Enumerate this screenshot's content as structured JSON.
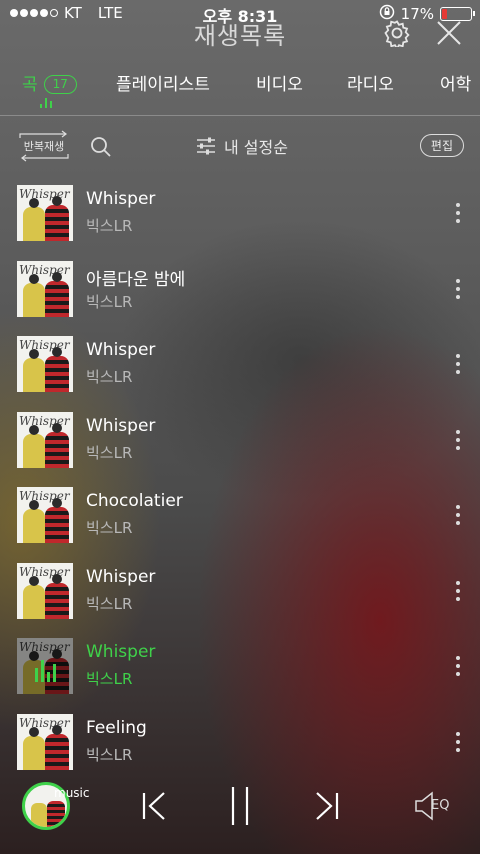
{
  "status": {
    "carrier": "KT",
    "network": "LTE",
    "time": "오후 8:31",
    "battery": "17%",
    "signal_bars": 4
  },
  "header": {
    "title": "재생목록"
  },
  "tabs": [
    {
      "label": "곡",
      "count": "17",
      "active": true
    },
    {
      "label": "플레이리스트"
    },
    {
      "label": "비디오"
    },
    {
      "label": "라디오"
    },
    {
      "label": "어학"
    }
  ],
  "toolbar": {
    "repeat_label": "반복재생",
    "sort_label": "내 설정순",
    "edit_label": "편집"
  },
  "songs": [
    {
      "title": "Whisper",
      "artist": "빅스LR",
      "cover_text": "Whisper"
    },
    {
      "title": "아름다운 밤에",
      "artist": "빅스LR",
      "cover_text": "Whisper"
    },
    {
      "title": "Whisper",
      "artist": "빅스LR",
      "cover_text": "Whisper"
    },
    {
      "title": "Whisper",
      "artist": "빅스LR",
      "cover_text": "Whisper"
    },
    {
      "title": "Chocolatier",
      "artist": "빅스LR",
      "cover_text": "Whisper"
    },
    {
      "title": "Whisper",
      "artist": "빅스LR",
      "cover_text": "Whisper"
    },
    {
      "title": "Whisper",
      "artist": "빅스LR",
      "cover_text": "Whisper",
      "now_playing": true
    },
    {
      "title": "Feeling",
      "artist": "빅스LR",
      "cover_text": "Whisper"
    }
  ],
  "player": {
    "mini_label": "music",
    "eq_label": "EQ"
  },
  "colors": {
    "accent": "#3fd14a",
    "battery_low": "#e53935"
  }
}
